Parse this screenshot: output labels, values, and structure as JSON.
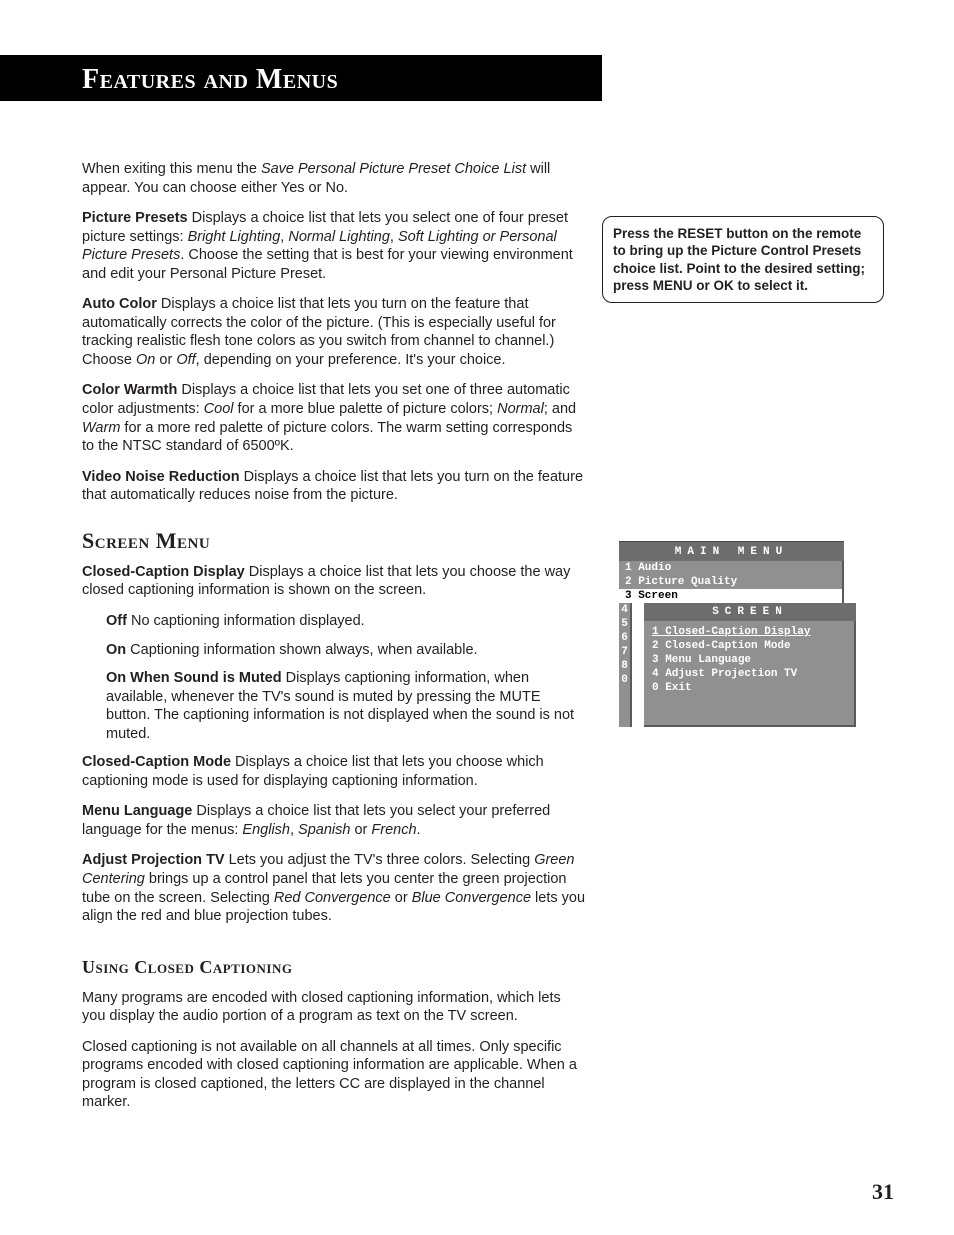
{
  "chapter_title": "Features and Menus",
  "intro": {
    "prefix": "When exiting this menu the ",
    "italic": "Save Personal Picture Preset Choice List",
    "suffix": " will appear. You can choose either Yes or No."
  },
  "picture_presets": {
    "label": "Picture Presets",
    "t1": "  Displays a choice list that lets you select one of four preset picture settings: ",
    "i1": "Bright Lighting",
    "c1": ", ",
    "i2": "Normal Lighting",
    "c2": ", ",
    "i3": "Soft Lighting or Personal Picture Presets",
    "t2": ". Choose the setting that is best for your viewing environment and edit your Personal Picture Preset."
  },
  "auto_color": {
    "label": "Auto Color",
    "t1": "   Displays a choice list that lets you turn on the feature that automatically corrects the color of the picture. (This is especially useful for tracking realistic flesh tone colors as you switch from channel to channel.) Choose ",
    "i1": "On",
    "c1": " or ",
    "i2": "Off",
    "t2": ", depending on your preference. It's your choice."
  },
  "color_warmth": {
    "label": "Color Warmth",
    "t1": "   Displays a choice list that lets you set one of three automatic color adjustments: ",
    "i1": "Cool",
    "c1": " for a more blue palette of picture colors; ",
    "i2": "Normal",
    "c2": "; and ",
    "i3": "Warm",
    "t2": " for a more red palette of picture colors. The warm setting corresponds to the NTSC standard of 6500ºK."
  },
  "video_noise": {
    "label": "Video Noise Reduction",
    "t1": "  Displays a choice list that lets you turn on the feature that automatically reduces noise from the picture."
  },
  "screen_menu_heading": "Screen Menu",
  "cc_display": {
    "label": "Closed-Caption Display",
    "t1": "   Displays a choice list that lets you choose the way closed captioning information is shown on the screen."
  },
  "cc_off": {
    "label": "Off",
    "text": "  No captioning information displayed."
  },
  "cc_on": {
    "label": "On",
    "text": "  Captioning information shown always, when available."
  },
  "cc_mute": {
    "label": "On When Sound is Muted",
    "text": "   Displays captioning information, when available, whenever the TV's sound is muted by pressing the MUTE button. The captioning information is not displayed when the sound is not muted."
  },
  "cc_mode": {
    "label": "Closed-Caption Mode",
    "t1": "   Displays a choice list that lets you choose which captioning mode is used for displaying captioning information."
  },
  "menu_lang": {
    "label": "Menu Language",
    "t1": "   Displays a choice list that lets you select your preferred language for the menus: ",
    "i1": "English",
    "c1": ", ",
    "i2": "Spanish",
    "c2": " or ",
    "i3": "French",
    "t2": "."
  },
  "adjust_ptv": {
    "label": "Adjust Projection TV",
    "t1": " Lets you adjust the TV's three colors.  Selecting ",
    "i1": "Green Centering",
    "c1": " brings up a control panel that lets you center the green projection tube on the screen. Selecting ",
    "i2": "Red Convergence",
    "c2": " or ",
    "i3": "Blue Convergence",
    "t2": " lets you align the red and blue projection tubes."
  },
  "using_cc_heading": "Using Closed Captioning",
  "using_cc_p1": "Many programs are encoded with closed captioning information, which lets you display the audio portion of a program as text on the TV screen.",
  "using_cc_p2": "Closed captioning is not available on all channels at all times. Only specific programs encoded with closed captioning information are applicable. When a program is closed captioned, the letters CC are displayed in the channel marker.",
  "tip_box": "Press the RESET button on the remote to bring up the Picture Control Presets choice list. Point to the desired setting; press MENU or OK to select it.",
  "osd": {
    "main_title": "MAIN MENU",
    "rows": {
      "r1": "1 Audio",
      "r2": "2 Picture Quality",
      "r3": "3 Screen",
      "n4": "4",
      "n5": "5",
      "n6": "6",
      "n7": "7",
      "n8": "8",
      "n0": "0"
    },
    "sub_title": "SCREEN",
    "sub": {
      "s1": "1 Closed-Caption Display",
      "s2": "2 Closed-Caption Mode",
      "s3": "3 Menu Language",
      "s4": "4 Adjust Projection TV",
      "s0": "0 Exit"
    }
  },
  "page_number": "31"
}
